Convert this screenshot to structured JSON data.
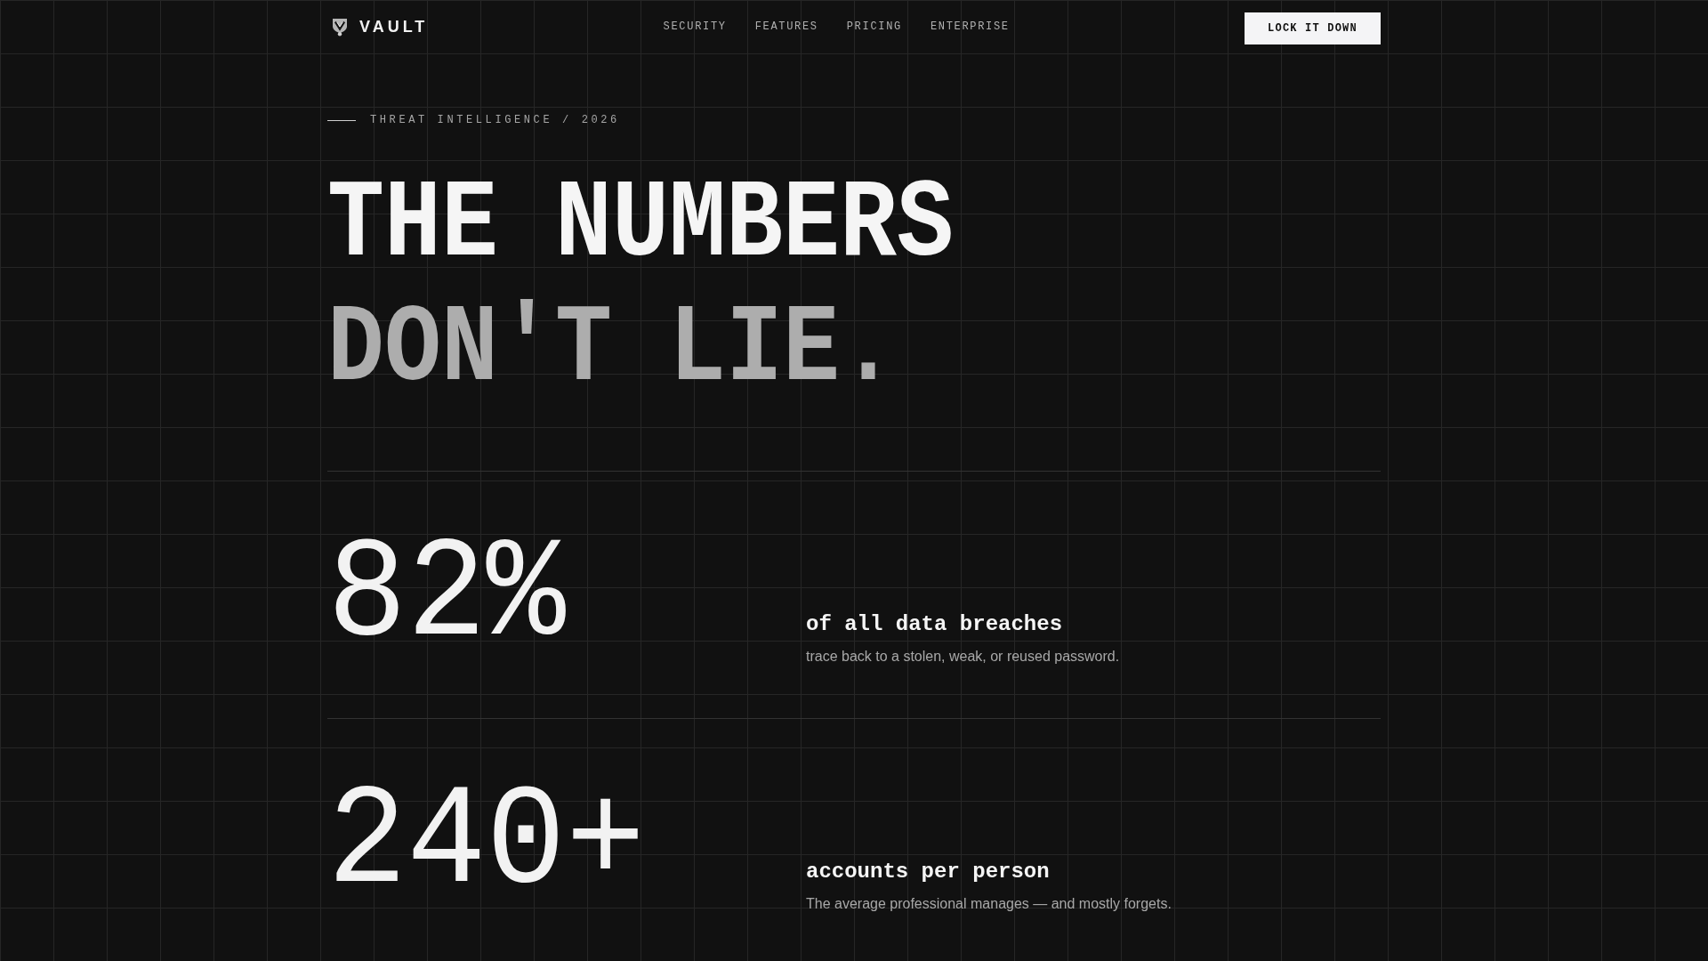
{
  "header": {
    "brand": "VAULT",
    "nav": [
      {
        "label": "SECURITY"
      },
      {
        "label": "FEATURES"
      },
      {
        "label": "PRICING"
      },
      {
        "label": "ENTERPRISE"
      }
    ],
    "cta": "LOCK IT DOWN"
  },
  "hero": {
    "eyebrow": "THREAT INTELLIGENCE / 2026",
    "headline": [
      {
        "text": "THE NUMBERS",
        "kind": "bright"
      },
      {
        "text": "DON'T LIE.",
        "kind": "muted"
      }
    ]
  },
  "stats": [
    {
      "value": "82%",
      "title": "of all data breaches",
      "description": "trace back to a stolen, weak, or reused password."
    },
    {
      "value": "240+",
      "title": "accounts per person",
      "description": "The average professional manages — and mostly forgets."
    }
  ]
}
